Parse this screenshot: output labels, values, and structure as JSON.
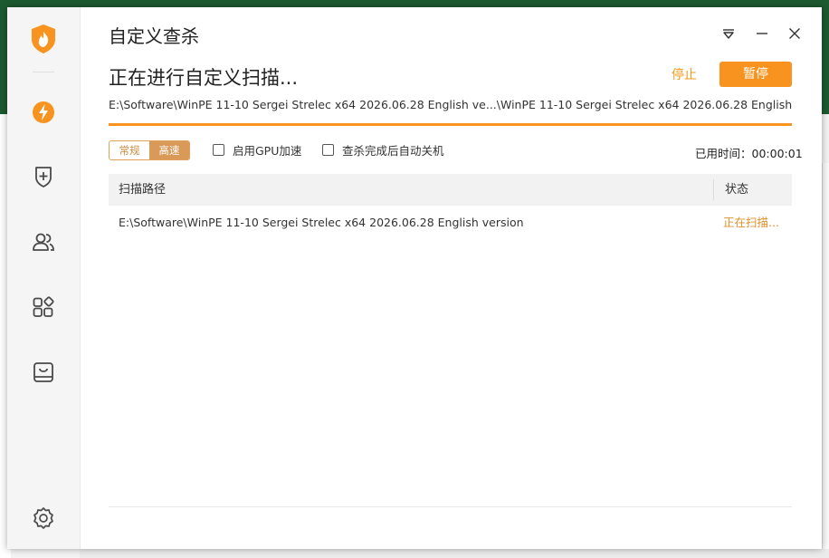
{
  "window": {
    "title": "自定义查杀"
  },
  "scan": {
    "heading": "正在进行自定义扫描...",
    "stop_label": "停止",
    "pause_label": "暂停",
    "current_path": "E:\\Software\\WinPE 11-10 Sergei Strelec x64 2026.06.28 English ve...\\WinPE 11-10 Sergei Strelec x64 2026.06.28 English version.iso",
    "progress_percent": 100
  },
  "options": {
    "modes": [
      "常规",
      "高速"
    ],
    "active_mode": "高速",
    "gpu_label": "启用GPU加速",
    "shutdown_label": "查杀完成后自动关机",
    "elapsed_label": "已用时间：",
    "elapsed_value": "00:00:01"
  },
  "table": {
    "headers": [
      "扫描路径",
      "状态"
    ],
    "rows": [
      {
        "path": "E:\\Software\\WinPE 11-10 Sergei Strelec x64 2026.06.28 English version",
        "status": "正在扫描..."
      }
    ]
  },
  "sidebar": {
    "items": [
      "shield-flame-logo",
      "lightning-icon",
      "shield-plus-icon",
      "users-icon",
      "apps-icon",
      "toolbox-icon",
      "settings-icon"
    ]
  },
  "colors": {
    "accent": "#f7931e",
    "mode_active": "#d99a58",
    "status_text": "#e0902a"
  }
}
